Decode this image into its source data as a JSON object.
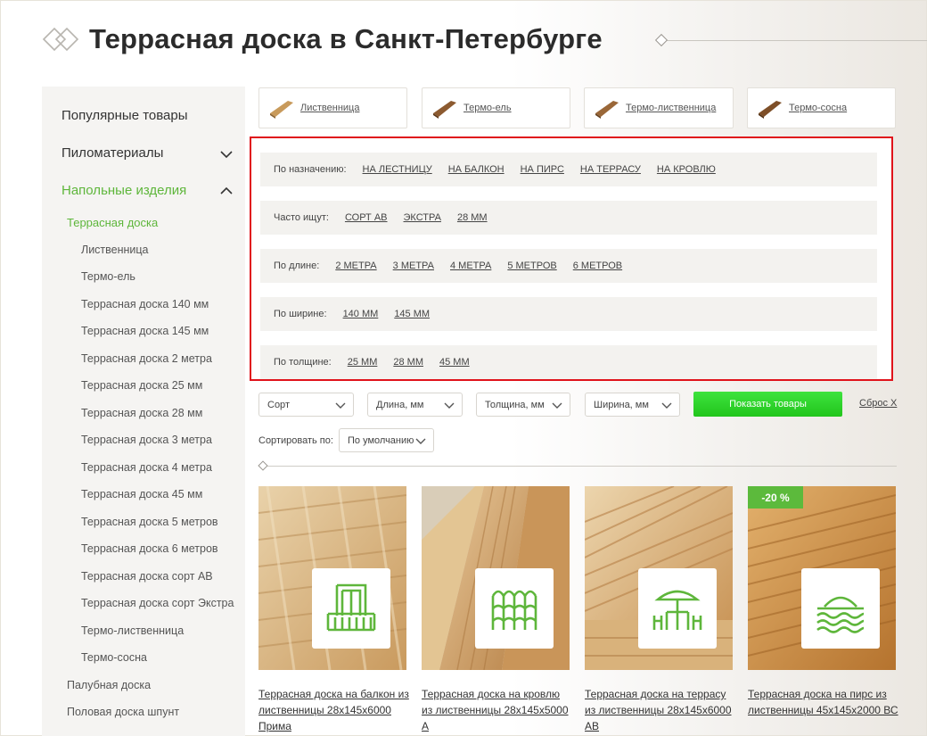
{
  "header": {
    "title": "Террасная доска в Санкт-Петербурге"
  },
  "sidebar": {
    "top_items": [
      {
        "label": "Популярные товары"
      },
      {
        "label": "Пиломатериалы"
      },
      {
        "label": "Напольные изделия"
      }
    ],
    "active_section": "Террасная доска",
    "sub_items": [
      "Лиственница",
      "Термо-ель",
      "Террасная доска 140 мм",
      "Террасная доска 145 мм",
      "Террасная доска 2 метра",
      "Террасная доска 25 мм",
      "Террасная доска 28 мм",
      "Террасная доска 3 метра",
      "Террасная доска 4 метра",
      "Террасная доска 45 мм",
      "Террасная доска 5 метров",
      "Террасная доска 6 метров",
      "Террасная доска сорт АВ",
      "Террасная доска сорт Экстра",
      "Термо-лиственница",
      "Термо-сосна"
    ],
    "other_sections": [
      "Палубная доска",
      "Половая доска шпунт"
    ],
    "accent_color": "#5eb63b"
  },
  "categories": [
    {
      "label": "Лиственница"
    },
    {
      "label": "Термо-ель"
    },
    {
      "label": "Термо-лиственница"
    },
    {
      "label": "Термо-сосна"
    }
  ],
  "tag_groups": [
    {
      "label": "По назначению:",
      "tags": [
        "НА ЛЕСТНИЦУ",
        "НА БАЛКОН",
        "НА ПИРС",
        "НА ТЕРРАСУ",
        "НА КРОВЛЮ"
      ]
    },
    {
      "label": "Часто ищут:",
      "tags": [
        "СОРТ АВ",
        "ЭКСТРА",
        "28 ММ"
      ]
    },
    {
      "label": "По длине:",
      "tags": [
        "2 МЕТРА",
        "3 МЕТРА",
        "4 МЕТРА",
        "5 МЕТРОВ",
        "6 МЕТРОВ"
      ]
    },
    {
      "label": "По ширине:",
      "tags": [
        "140 ММ",
        "145 ММ"
      ]
    },
    {
      "label": "По толщине:",
      "tags": [
        "25 ММ",
        "28 ММ",
        "45 ММ"
      ]
    }
  ],
  "filters": {
    "sort_grade": "Сорт",
    "length": "Длина, мм",
    "thickness": "Толщина, мм",
    "width": "Ширина, мм",
    "show_button": "Показать товары",
    "reset": "Сброс X",
    "sort_label": "Сортировать по:",
    "sort_value": "По умолчанию",
    "button_color": "#2ed42a"
  },
  "products": [
    {
      "title": "Террасная доска на балкон из лиственницы 28х145х6000 Прима",
      "icon": "balcony-icon",
      "badge": ""
    },
    {
      "title": "Террасная доска на кровлю из лиственницы 28х145х5000 А",
      "icon": "roof-tiles-icon",
      "badge": ""
    },
    {
      "title": "Террасная доска на террасу из лиственницы 28х145х6000 АВ",
      "icon": "terrace-umbrella-icon",
      "badge": ""
    },
    {
      "title": "Террасная доска на пирс из лиственницы 45х145х2000 ВС",
      "icon": "pier-waves-icon",
      "badge": "-20 %"
    }
  ]
}
